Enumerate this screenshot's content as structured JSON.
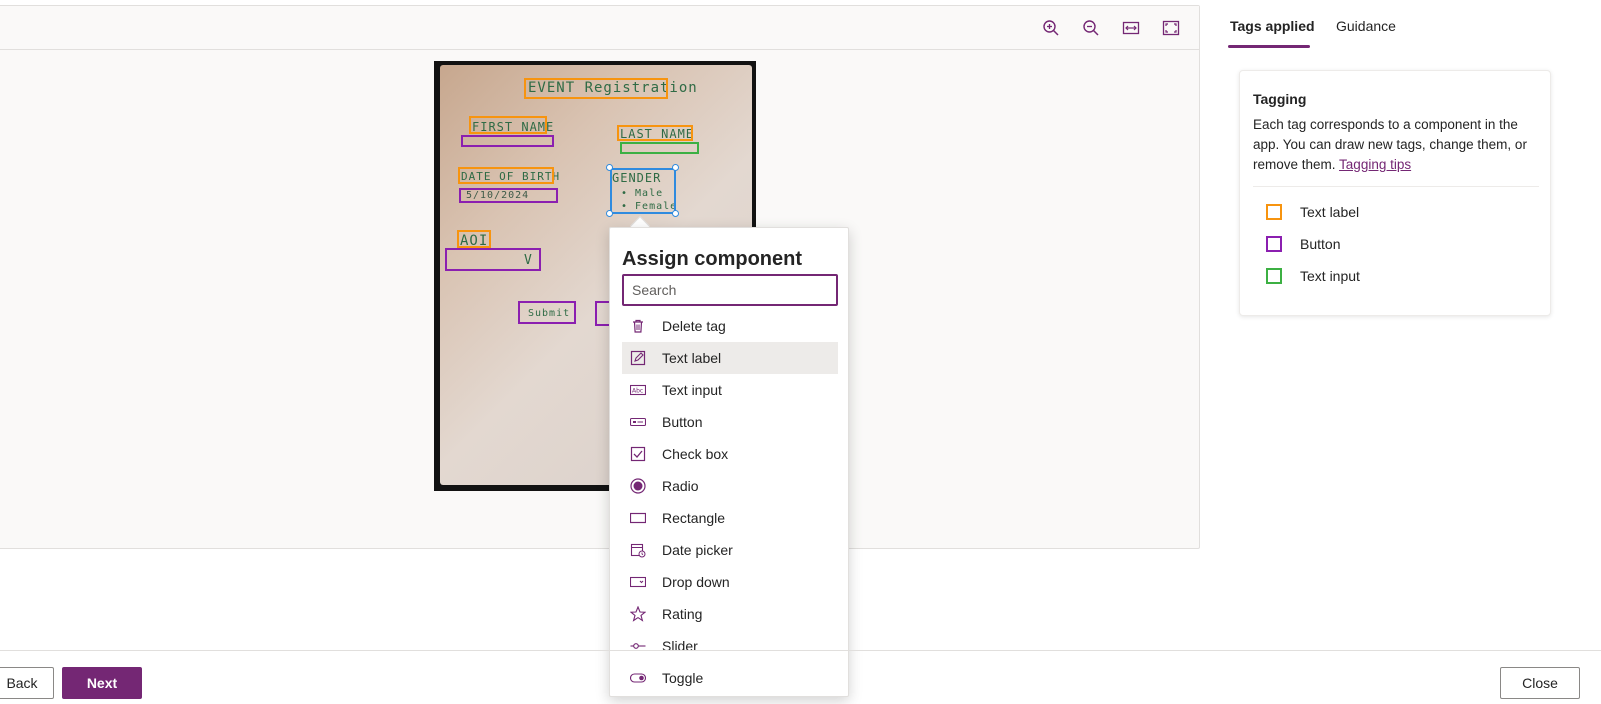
{
  "toolbar": {
    "icons": [
      "zoom-in-icon",
      "zoom-out-icon",
      "fit-width-icon",
      "fit-screen-icon"
    ]
  },
  "sketch": {
    "labels": {
      "title": "EVENT Registration",
      "first_name": "FIRST NAME",
      "last_name": "LAST NAME",
      "dob": "DATE OF BIRTH",
      "dob_value": "5/10/2024",
      "gender": "GENDER",
      "male": "• Male",
      "female": "• Female",
      "aoi": "AOI",
      "dropdown_mark": "V",
      "submit": "Submit"
    }
  },
  "popup": {
    "title": "Assign component",
    "search_placeholder": "Search",
    "items": [
      {
        "label": "Delete tag",
        "icon": "trash-icon"
      },
      {
        "label": "Text label",
        "icon": "text-label-icon",
        "selected": true
      },
      {
        "label": "Text input",
        "icon": "text-input-icon"
      },
      {
        "label": "Button",
        "icon": "button-icon"
      },
      {
        "label": "Check box",
        "icon": "checkbox-icon"
      },
      {
        "label": "Radio",
        "icon": "radio-icon"
      },
      {
        "label": "Rectangle",
        "icon": "rectangle-icon"
      },
      {
        "label": "Date picker",
        "icon": "date-picker-icon"
      },
      {
        "label": "Drop down",
        "icon": "dropdown-icon"
      },
      {
        "label": "Rating",
        "icon": "star-icon"
      },
      {
        "label": "Slider",
        "icon": "slider-icon"
      },
      {
        "label": "Toggle",
        "icon": "toggle-icon"
      }
    ]
  },
  "right_panel": {
    "tabs": [
      {
        "label": "Tags applied",
        "active": true
      },
      {
        "label": "Guidance",
        "active": false
      }
    ],
    "card": {
      "title": "Tagging",
      "description": "Each tag corresponds to a component in the app. You can draw new tags, change them, or remove them.",
      "link": "Tagging tips"
    },
    "legend": [
      {
        "label": "Text label",
        "color": "#f7940f"
      },
      {
        "label": "Button",
        "color": "#8b1fb0"
      },
      {
        "label": "Text input",
        "color": "#3cb043"
      }
    ]
  },
  "footer": {
    "back_label": "Back",
    "next_label": "Next",
    "close_label": "Close"
  },
  "colors": {
    "accent": "#742774",
    "tag_orange": "#f7940f",
    "tag_purple": "#8b1fb0",
    "tag_green": "#3cb043",
    "tag_selected": "#2f8bdf"
  }
}
